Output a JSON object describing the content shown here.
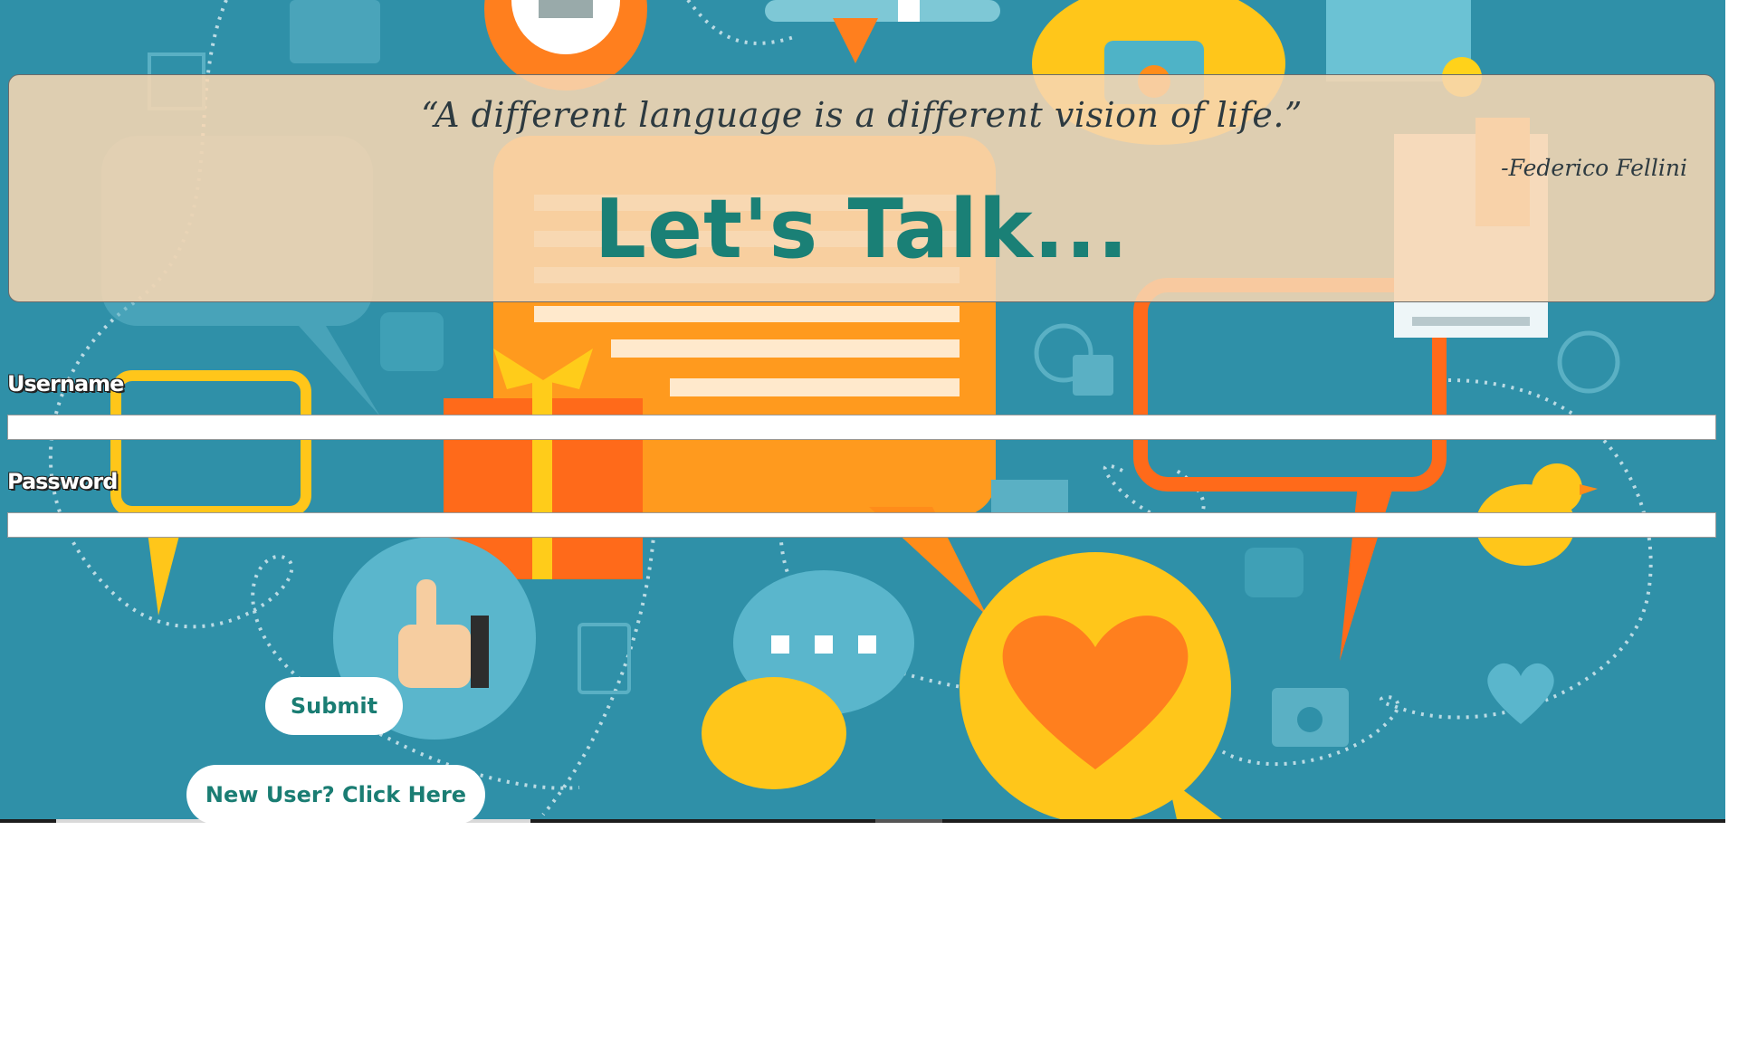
{
  "banner": {
    "quote": "“A different language is a different vision of life.”",
    "author": "-Federico Fellini",
    "title": "Let's Talk..."
  },
  "form": {
    "username_label": "Username",
    "username_value": "",
    "password_label": "Password",
    "password_value": "",
    "submit_label": "Submit",
    "new_user_label": "New User? Click Here"
  },
  "colors": {
    "background": "#2f90a8",
    "banner": "#f7d6b2",
    "accent": "#1a8076",
    "orange": "#ff8c1a",
    "yellow": "#ffc61a"
  }
}
